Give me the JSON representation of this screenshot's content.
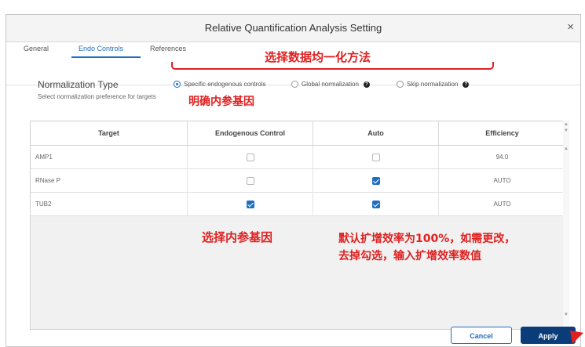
{
  "window": {
    "title": "Relative Quantification Analysis Setting",
    "close_glyph": "×"
  },
  "tabs": [
    {
      "label": "General",
      "active": false
    },
    {
      "label": "Endo Controls",
      "active": true
    },
    {
      "label": "References",
      "active": false
    }
  ],
  "normalization": {
    "heading": "Normalization Type",
    "subtitle": "Select normalization preference for targets",
    "options": [
      {
        "label": "Specific endogenous controls",
        "selected": true,
        "info": false
      },
      {
        "label": "Global normalization",
        "selected": false,
        "info": true
      },
      {
        "label": "Skip normalization",
        "selected": false,
        "info": true
      }
    ]
  },
  "table": {
    "columns": [
      "Target",
      "Endogenous Control",
      "Auto",
      "Efficiency"
    ],
    "rows": [
      {
        "target": "AMP1",
        "endogenous_control": false,
        "auto": false,
        "efficiency": "94.0"
      },
      {
        "target": "RNase P",
        "endogenous_control": false,
        "auto": true,
        "efficiency": "AUTO"
      },
      {
        "target": "TUB2",
        "endogenous_control": true,
        "auto": true,
        "efficiency": "AUTO"
      }
    ]
  },
  "buttons": {
    "cancel": "Cancel",
    "apply": "Apply"
  },
  "annotations": {
    "choose_method": "选择数据均一化方法",
    "specify_reference": "明确内参基因",
    "select_reference": "选择内参基因",
    "efficiency_note_line1": "默认扩增效率为100%，如需更改，",
    "efficiency_note_line2": "去掉勾选，输入扩增效率数值"
  },
  "colors": {
    "accent": "#1f6fbf",
    "apply_bg": "#0b3c7a",
    "annotation": "#e02020"
  }
}
